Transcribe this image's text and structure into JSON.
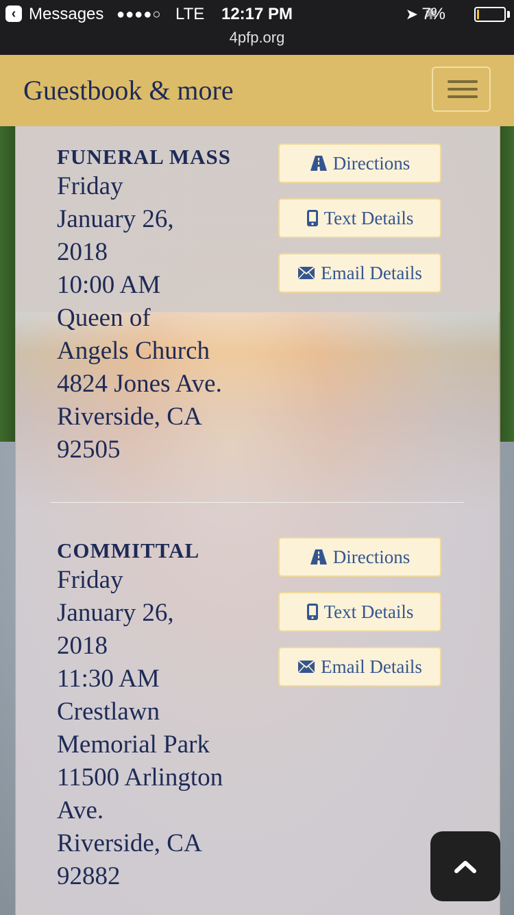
{
  "status_bar": {
    "carrier": "Messages",
    "signal": "●●●●○",
    "network": "LTE",
    "time": "12:17 PM",
    "battery": "7%",
    "battery_level": 0.07,
    "url": "4pfp.org"
  },
  "header": {
    "brand": "Guestbook & more",
    "menu_icon": "hamburger-icon"
  },
  "events": [
    {
      "title": "FUNERAL MASS",
      "lines": [
        "Friday",
        "January 26,",
        "2018",
        "10:00 AM",
        "Queen of",
        "Angels Church",
        "4824 Jones Ave.",
        "Riverside, CA",
        "92505"
      ],
      "buttons": {
        "directions": "Directions",
        "text": "Text Details",
        "email": "Email Details"
      }
    },
    {
      "title": "COMMITTAL",
      "lines": [
        "Friday",
        "January 26,",
        "2018",
        "11:30 AM",
        "Crestlawn",
        "Memorial Park",
        "11500 Arlington",
        "Ave.",
        "Riverside, CA",
        "92882"
      ],
      "buttons": {
        "directions": "Directions",
        "text": "Text Details",
        "email": "Email Details"
      }
    }
  ],
  "icons": {
    "directions": "road-icon",
    "text": "mobile-phone-icon",
    "email": "envelope-icon",
    "scroll_top": "chevron-up-icon"
  },
  "colors": {
    "header_bg": "#dcbc68",
    "brand_text": "#1e2a56",
    "button_bg": "#fbf2d8",
    "button_text": "#34558f"
  }
}
